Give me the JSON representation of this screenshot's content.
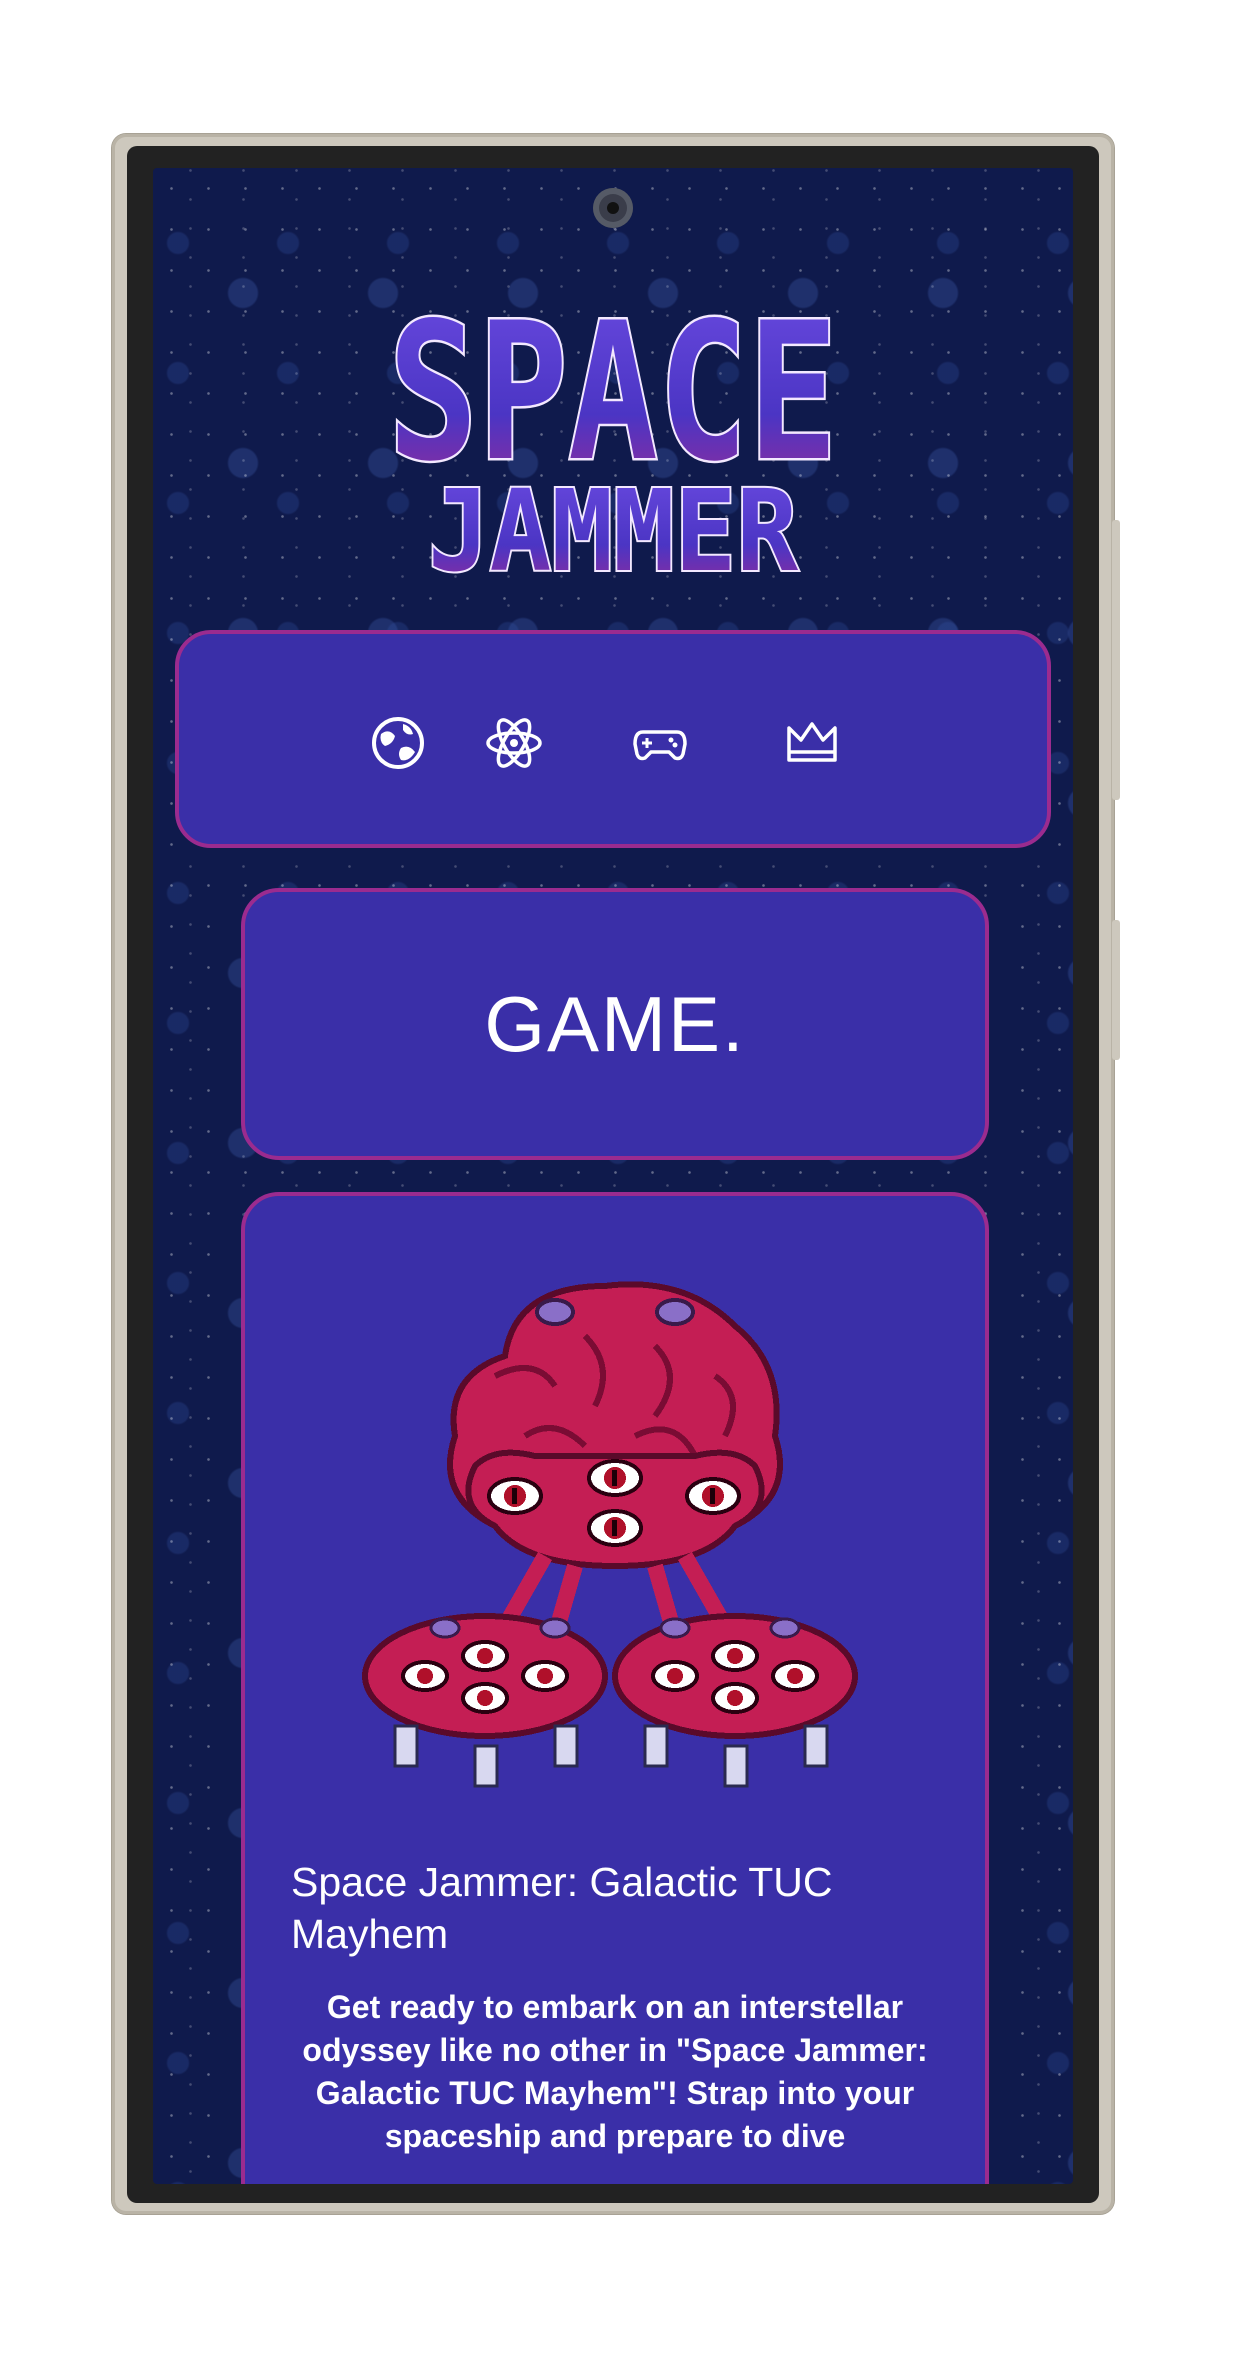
{
  "logo": {
    "line1": "SPACE",
    "line2": "JAMMER",
    "colors": {
      "fill": "#5b3fc9",
      "shade": "#8a2a9a",
      "outline": "#f3e8ff"
    }
  },
  "nav": {
    "items": [
      {
        "icon": "globe-icon"
      },
      {
        "icon": "atom-icon"
      },
      {
        "icon": "gamepad-icon"
      },
      {
        "icon": "crown-icon"
      }
    ]
  },
  "page": {
    "title": "GAME."
  },
  "game": {
    "title": "Space Jammer: Galactic TUC Mayhem",
    "description": "Get ready to embark on an interstellar odyssey like no other in \"Space Jammer: Galactic TUC Mayhem\"! Strap into your spaceship and prepare to dive",
    "image_icon": "brain-monster-icon"
  },
  "theme": {
    "background": "#0f1a4c",
    "card": "#3a2fa8",
    "card_border": "#9b2b8f",
    "text": "#ffffff"
  }
}
